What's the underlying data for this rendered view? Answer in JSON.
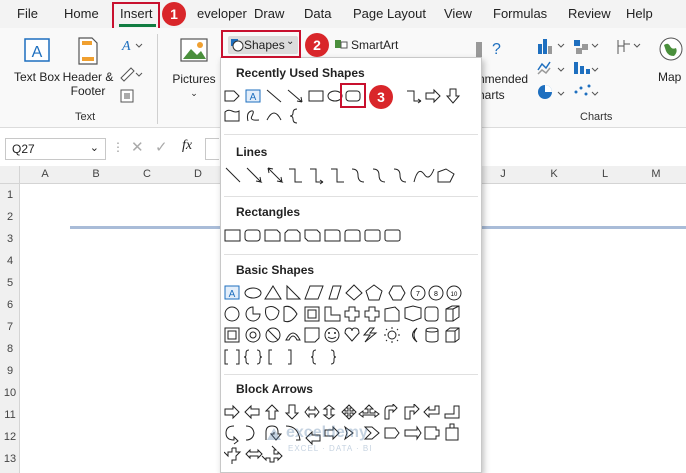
{
  "menu": {
    "tabs": [
      "File",
      "Home",
      "Insert",
      "eveloper",
      "Draw",
      "Data",
      "Page Layout",
      "View",
      "Formulas",
      "Review",
      "Help"
    ],
    "active": "Insert"
  },
  "ribbon": {
    "text_box": "Text Box",
    "header_footer": "Header & Footer",
    "text_group": "Text",
    "pictures": "Pictures",
    "shapes": "Shapes",
    "smartart": "SmartArt",
    "recommended_charts_line1": "nmended",
    "recommended_charts_line2": "harts",
    "charts_group": "Charts",
    "maps": "Map"
  },
  "formula_bar": {
    "name_box": "Q27",
    "fx": "fx"
  },
  "columns": [
    "A",
    "B",
    "C",
    "D",
    "J",
    "K",
    "L",
    "M"
  ],
  "rows": [
    "1",
    "2",
    "3",
    "4",
    "5",
    "6",
    "7",
    "8",
    "9",
    "10",
    "11",
    "12",
    "13"
  ],
  "dropdown": {
    "sections": [
      "Recently Used Shapes",
      "Lines",
      "Rectangles",
      "Basic Shapes",
      "Block Arrows"
    ]
  },
  "annotations": [
    "1",
    "2",
    "3"
  ],
  "watermark": {
    "title": "exceldemy",
    "subtitle": "EXCEL · DATA · BI"
  }
}
